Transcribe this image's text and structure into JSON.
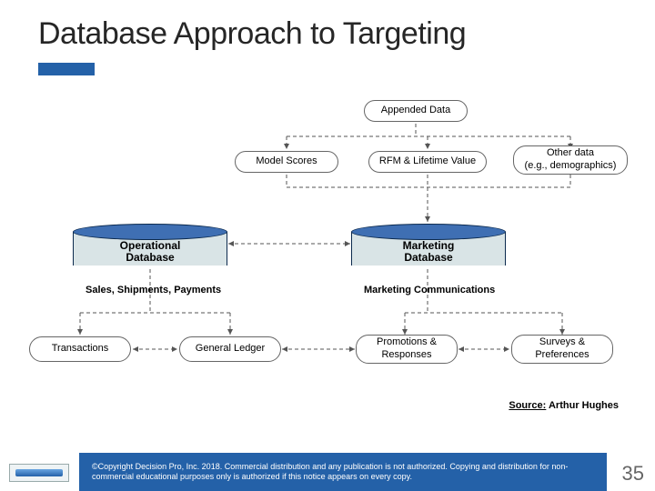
{
  "title": "Database Approach to Targeting",
  "boxes": {
    "appended_data": "Appended Data",
    "model_scores": "Model Scores",
    "rfm": "RFM & Lifetime Value",
    "other_data": "Other data\n(e.g., demographics)",
    "transactions": "Transactions",
    "general_ledger": "General Ledger",
    "promotions": "Promotions &\nResponses",
    "surveys": "Surveys &\nPreferences"
  },
  "dbs": {
    "operational": "Operational\nDatabase",
    "marketing": "Marketing\nDatabase"
  },
  "subtitles": {
    "left": "Sales, Shipments, Payments",
    "right": "Marketing Communications"
  },
  "source": {
    "label": "Source:",
    "value": " Arthur Hughes"
  },
  "footer": "©Copyright Decision Pro, Inc. 2018. Commercial distribution and any publication is not authorized. Copying and distribution for non-commercial educational purposes only is authorized if this notice appears on every copy.",
  "page_number": "35"
}
